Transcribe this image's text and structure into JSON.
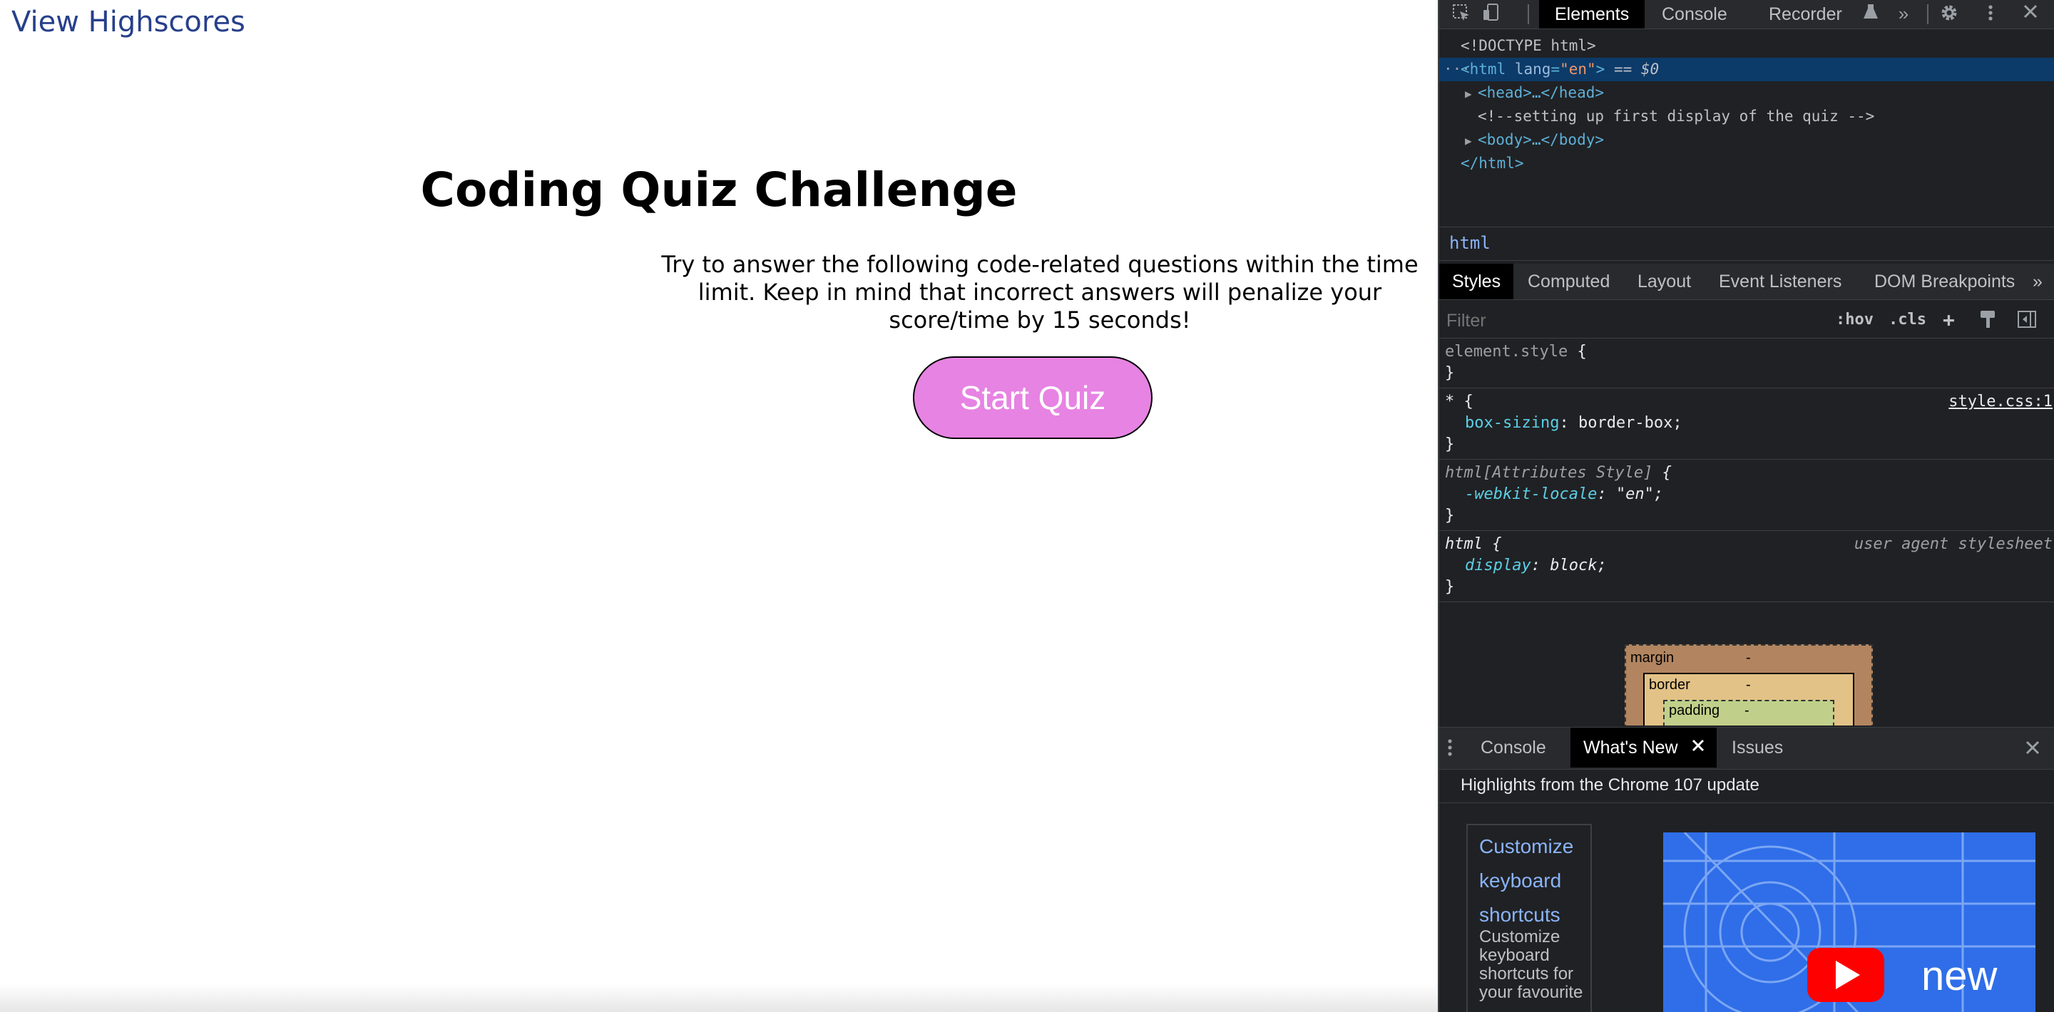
{
  "page": {
    "highscores_link": "View Highscores",
    "title": "Coding Quiz Challenge",
    "description": "Try to answer the following code-related questions within the time limit. Keep in mind that incorrect answers will penalize your score/time by 15 seconds!",
    "start_button": "Start Quiz",
    "colors": {
      "button_bg": "#e783e3",
      "link": "#27408b"
    }
  },
  "devtools": {
    "tabs": [
      "Elements",
      "Console",
      "Recorder"
    ],
    "active_tab": "Elements",
    "more_tabs": "»",
    "dom": {
      "doctype": "<!DOCTYPE html>",
      "html_open_prefix": "<html ",
      "html_attr_name": "lang",
      "html_attr_eq": "=",
      "html_attr_value": "\"en\"",
      "html_open_suffix": ">",
      "selected_marker": "== $0",
      "head": "<head>…</head>",
      "comment": "<!--setting up first display of the quiz -->",
      "body": "<body>…</body>",
      "html_close": "</html>"
    },
    "breadcrumb": "html",
    "subtabs": [
      "Styles",
      "Computed",
      "Layout",
      "Event Listeners",
      "DOM Breakpoints"
    ],
    "active_subtab": "Styles",
    "filter_placeholder": "Filter",
    "filter_buttons": {
      "hov": ":hov",
      "cls": ".cls",
      "add": "+"
    },
    "rules": {
      "element_style": "element.style",
      "universal_selector": "*",
      "universal_source": "style.css:1",
      "box_sizing_prop": "box-sizing",
      "box_sizing_value": "border-box;",
      "attr_selector": "html[Attributes Style]",
      "locale_prop": "-webkit-locale",
      "locale_value": "\"en\";",
      "html_selector": "html",
      "ua_source": "user agent stylesheet",
      "display_prop": "display",
      "display_value": "block;",
      "open_brace": "{",
      "close_brace": "}"
    },
    "box_model": {
      "margin": "margin",
      "border": "border",
      "padding": "padding",
      "dash": "-"
    },
    "drawer_tabs": [
      "Console",
      "What's New",
      "Issues"
    ],
    "active_drawer_tab": "What's New",
    "whats_new_heading": "Highlights from the Chrome 107 update",
    "card": {
      "link": "Customize keyboard shortcuts",
      "description": "Customize keyboard shortcuts for your favourite"
    },
    "video_label": "new"
  }
}
